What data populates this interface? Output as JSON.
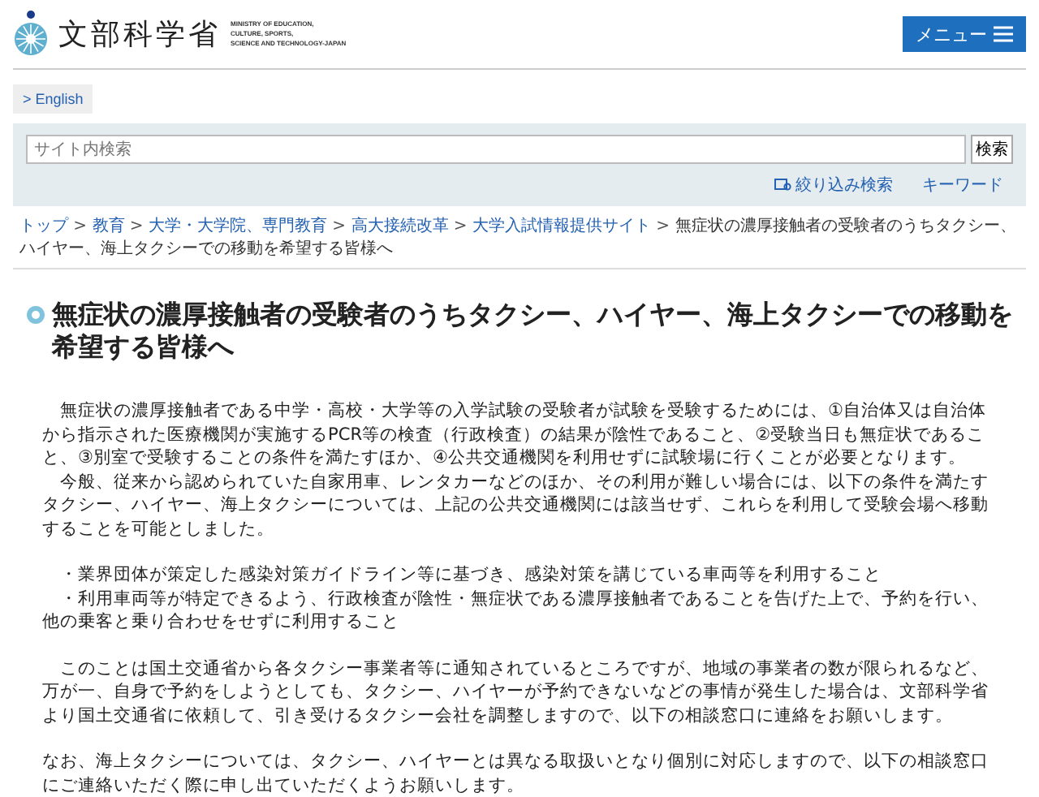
{
  "header": {
    "logo_text": "文部科学省",
    "logo_subtitle": [
      "MINISTRY OF EDUCATION,",
      "CULTURE, SPORTS,",
      "SCIENCE AND TECHNOLOGY-JAPAN"
    ],
    "menu_button": "メニュー"
  },
  "language_link": "> English",
  "search": {
    "placeholder": "サイト内検索",
    "button": "検索",
    "links": [
      {
        "label": "絞り込み検索",
        "icon": true
      },
      {
        "label": "キーワード",
        "icon": false
      }
    ]
  },
  "breadcrumb": {
    "separator": ">",
    "links": [
      "トップ",
      "教育",
      "大学・大学院、専門教育",
      "高大接続改革",
      "大学入試情報提供サイト"
    ],
    "current_lines": [
      "無症状の濃厚接触者の受験者のうちタクシー、",
      "ハイヤー、海上タクシーでの移動を希望する皆様へ"
    ]
  },
  "title": "無症状の濃厚接触者の受験者のうちタクシー、ハイヤー、海上タクシーでの移動を希望する皆様へ",
  "paragraphs": [
    {
      "kind": "text",
      "lines": [
        "　無症状の濃厚接触者である中学・高校・大学等の入学試験の受験者が試験を受験するためには、①自治体又は自治体から指示された医療機関が実施するPCR等の検査（行政検査）の結果が陰性であること、②受験当日も無症状であること、③別室で受験することの条件を満たすほか、④公共交通機関を利用せずに試験場に行くことが必要となります。",
        "　今般、従来から認められていた自家用車、レンタカーなどのほか、その利用が難しい場合には、以下の条件を満たすタクシー、ハイヤー、海上タクシーについては、上記の公共交通機関には該当せず、これらを利用して受験会場へ移動することを可能としました。"
      ]
    },
    {
      "kind": "text",
      "lines": [
        "　・業界団体が策定した感染対策ガイドライン等に基づき、感染対策を講じている車両等を利用すること",
        "　・利用車両等が特定できるよう、行政検査が陰性・無症状である濃厚接触者であることを告げた上で、予約を行い、他の乗客と乗り合わせをせずに利用すること"
      ]
    },
    {
      "kind": "text",
      "lines": [
        "　このことは国土交通省から各タクシー事業者等に通知されているところですが、地域の事業者の数が限られるなど、万が一、自身で予約をしようとしても、タクシー、ハイヤーが予約できないなどの事情が発生した場合は、文部科学省より国土交通省に依頼して、引き受けるタクシー会社を調整しますので、以下の相談窓口に連絡をお願いします。"
      ]
    },
    {
      "kind": "text",
      "lines": [
        "なお、海上タクシーについては、タクシー、ハイヤーとは異なる取扱いとなり個別に対応しますので、以下の相談窓口にご連絡いただく際に申し出ていただくようお願いします。"
      ]
    }
  ]
}
